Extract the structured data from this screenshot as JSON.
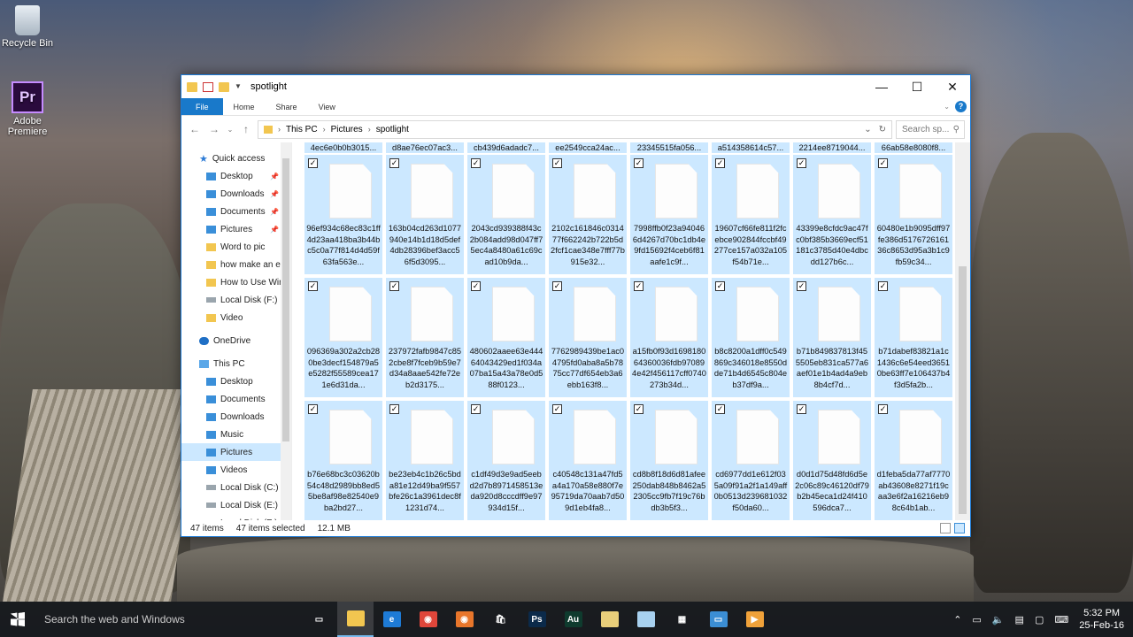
{
  "desktop": {
    "icons": [
      {
        "label": "Recycle Bin"
      },
      {
        "label": "Adobe Premiere",
        "glyph": "Pr"
      }
    ]
  },
  "window": {
    "title": "spotlight",
    "ribbon_tabs": [
      "File",
      "Home",
      "Share",
      "View"
    ],
    "help": "?",
    "breadcrumb": [
      "This PC",
      "Pictures",
      "spotlight"
    ],
    "search_placeholder": "Search sp...",
    "nav": {
      "quick_access": "Quick access",
      "pinned": [
        "Desktop",
        "Downloads",
        "Documents",
        "Pictures",
        "Word to pic",
        "how make an ey",
        "How to Use Wir",
        "Local Disk (F:)",
        "Video"
      ],
      "onedrive": "OneDrive",
      "this_pc": "This PC",
      "pc_items": [
        "Desktop",
        "Documents",
        "Downloads",
        "Music",
        "Pictures",
        "Videos",
        "Local Disk (C:)",
        "Local Disk (E:)",
        "Local Disk (F:)"
      ],
      "selected": "Pictures"
    },
    "partial_row": [
      "4ec6e0b0b3015...",
      "d8ae76ec07ac3...",
      "cb439d6adadc7...",
      "ee2549cca24ac...",
      "23345515fa056...",
      "a514358614c57...",
      "2214ee8719044...",
      "66ab58e8080f8..."
    ],
    "files": [
      "96ef934c68ec83c1ff4d23aa418ba3b44bc5c0a77f814d4d59f63fa563e...",
      "163b04cd263d1077940e14b1d18d5def4db28396bef3acc56f5d3095...",
      "2043cd939388f43c2b084add98d047ff75ec4a8480a61c69cad10b9da...",
      "2102c161846c031477f662242b722b5d2fcf1cae348e7fff77b915e32...",
      "7998ffb0f23a940466d4267d70bc1db4e9fd15692f4ceb6f81aafe1c9f...",
      "19607cf66fe811f2fcebce902844fccbf49277ce157a032a105f54b71e...",
      "43399e8cfdc9ac47fc0bf385b3669ecf51181c3785d40e4dbcdd127b6c...",
      "60480e1b9095dff97fe386d517672616136c8653d95a3b1c9fb59c34...",
      "096369a302a2cb280be3decf154879a5e5282f55589cea171e6d31da...",
      "237972fafb9847c852cbe8f7fceb9b59e7d34a8aae542fe72eb2d3175...",
      "480602aaee63e44464043429ed1f034a07ba15a43a78e0d588f0123...",
      "7762989439be1ac04795fd0aba8a5b7875cc77df654eb3a6ebb163f8...",
      "a15fb0f93d169818064360036fdb970894e42f456117cff0740273b34d...",
      "b8c8200a1dff0c549869c346018e8550dde71b4d6545c804eb37df9a...",
      "b71b849837813f455505eb831ca577a6aef01e1b4ad4a9eb8b4cf7d...",
      "b71dabef83821a1c1436c6e54eed36510be63ff7e106437b4f3d5fa2b...",
      "b76e68bc3c03620b54c48d2989bb8ed55be8af98e82540e9ba2bd27...",
      "be23eb4c1b26c5bda81e12d49ba9f557bfe26c1a3961dec8f1231d74...",
      "c1df49d3e9ad5eebd2d7b8971458513eda920d8cccdff9e97934d15f...",
      "c40548c131a47fd5a4a170a58e880f7e95719da70aab7d509d1eb4fa8...",
      "cd8b8f18d6d81afee250dab848b8462a52305cc9fb7f19c76bdb3b5f3...",
      "cd6977dd1e612f035a09f91a2f1a149aff0b0513d239681032f50da60...",
      "d0d1d75d48fd6d5e2c06c89c46120df79b2b45eca1d24f410596dca7...",
      "d1feba5da77af7770ab43608e8271f19caa3e6f2a16216eb98c64b1ab..."
    ],
    "status": {
      "count": "47 items",
      "selected": "47 items selected",
      "size": "12.1 MB"
    }
  },
  "taskbar": {
    "search": "Search the web and Windows",
    "apps": [
      "task-view",
      "file-explorer",
      "edge",
      "chrome",
      "firefox",
      "store",
      "photoshop",
      "audition",
      "folder",
      "notepad",
      "calculator",
      "remote",
      "media-player"
    ],
    "time": "5:32 PM",
    "date": "25-Feb-16"
  }
}
